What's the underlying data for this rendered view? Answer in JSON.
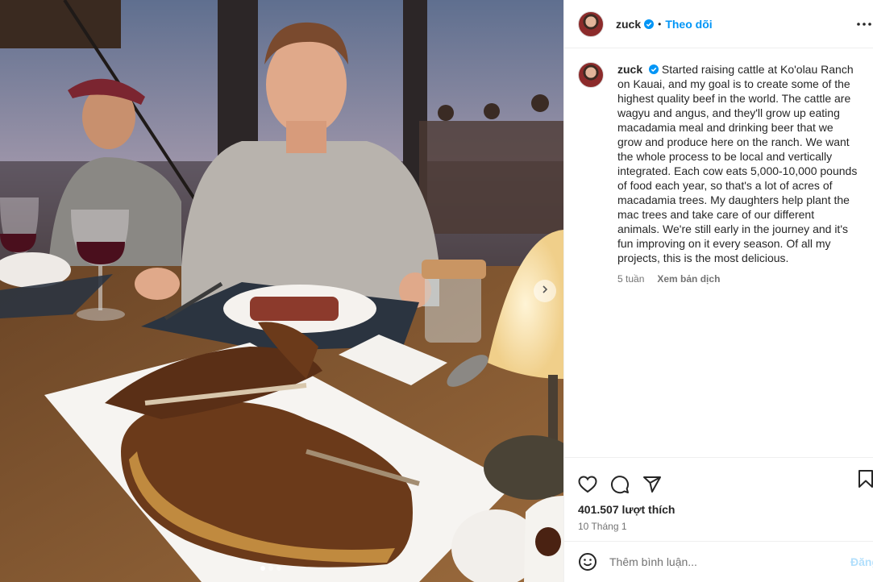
{
  "post": {
    "username": "zuck",
    "follow_label": "Theo dõi",
    "separator": "•",
    "caption": "Started raising cattle at Ko'olau Ranch on Kauai, and my goal is to create some of the highest quality beef in the world. The cattle are wagyu and angus, and they'll grow up eating macadamia meal and drinking beer that we grow and produce here on the ranch. We want the whole process to be local and vertically integrated. Each cow eats 5,000-10,000 pounds of food each year, so that's a lot of acres of macadamia trees. My daughters help plant the mac trees and take care of our different animals. We're still early in the journey and it's fun improving on it every season. Of all my projects, this is the most delicious.",
    "time_ago": "5 tuần",
    "translate_label": "Xem bản dịch",
    "likes": "401.507 lượt thích",
    "date": "10 Tháng 1"
  },
  "comment_box": {
    "placeholder": "Thêm bình luận...",
    "post_label": "Đăng"
  },
  "carousel": {
    "total": 3,
    "current": 1
  },
  "icons": {
    "verified": "verified-badge-icon",
    "more": "more-options-icon",
    "like": "heart-icon",
    "comment": "comment-icon",
    "share": "share-icon",
    "save": "bookmark-icon",
    "emoji": "emoji-icon",
    "next": "chevron-right-icon"
  },
  "colors": {
    "accent": "#0095f6",
    "verified": "#0095f6",
    "muted": "#737373",
    "post_disabled": "#b2dffc"
  }
}
